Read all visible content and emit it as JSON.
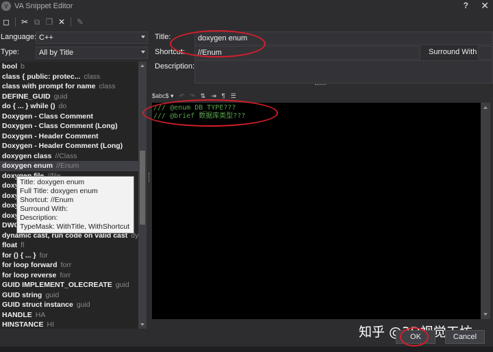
{
  "window": {
    "title": "VA Snippet Editor",
    "help_label": "?",
    "close_label": "✕"
  },
  "toolbar": {
    "icons": [
      "new-icon",
      "cut-icon",
      "copy-icon",
      "paste-icon",
      "delete-icon",
      "edit-icon"
    ]
  },
  "filters": {
    "language_label": "Language:",
    "language_value": "C++",
    "type_label": "Type:",
    "type_value": "All by Title"
  },
  "snippets": [
    {
      "title": "bool",
      "shortcut": "b"
    },
    {
      "title": "class  { public: protec...",
      "shortcut": "class"
    },
    {
      "title": "class with prompt for name",
      "shortcut": "class"
    },
    {
      "title": "DEFINE_GUID",
      "shortcut": "guid"
    },
    {
      "title": "do { ... } while ()",
      "shortcut": "do"
    },
    {
      "title": "Doxygen - Class Comment",
      "shortcut": ""
    },
    {
      "title": "Doxygen - Class Comment (Long)",
      "shortcut": ""
    },
    {
      "title": "Doxygen - Header Comment",
      "shortcut": ""
    },
    {
      "title": "Doxygen - Header Comment (Long)",
      "shortcut": ""
    },
    {
      "title": "doxygen class",
      "shortcut": "//Class"
    },
    {
      "title": "doxygen enum",
      "shortcut": "//Enum"
    },
    {
      "title": "doxygen file",
      "shortcut": "//file"
    },
    {
      "title": "doxygen function",
      "shortcut": ""
    },
    {
      "title": "doxygen group",
      "shortcut": ""
    },
    {
      "title": "doxygen member",
      "shortcut": ""
    },
    {
      "title": "doxygen struct",
      "shortcut": ""
    },
    {
      "title": "DWORD",
      "shortcut": ""
    },
    {
      "title": "dynamic cast, run code on valid cast",
      "shortcut": "dyn"
    },
    {
      "title": "float",
      "shortcut": "fl"
    },
    {
      "title": "for () { ... }",
      "shortcut": "for"
    },
    {
      "title": "for loop forward",
      "shortcut": "forr"
    },
    {
      "title": "for loop reverse",
      "shortcut": "forr"
    },
    {
      "title": "GUID IMPLEMENT_OLECREATE",
      "shortcut": "guid"
    },
    {
      "title": "GUID string",
      "shortcut": "guid"
    },
    {
      "title": "GUID struct instance",
      "shortcut": "guid"
    },
    {
      "title": "HANDLE",
      "shortcut": "HA"
    },
    {
      "title": "HINSTANCE",
      "shortcut": "HI"
    }
  ],
  "tooltip": {
    "lines": [
      "Title: doxygen enum",
      "Full Title: doxygen enum",
      "Shortcut: //Enum",
      "Surround With:",
      "Description:",
      "TypeMask: WithTitle, WithShortcut"
    ]
  },
  "editor_form": {
    "title_label": "Title:",
    "title_value": "doxygen enum",
    "shortcut_label": "Shortcut:",
    "shortcut_value": "//Enum",
    "surround_label": "Surround With",
    "description_label": "Description:"
  },
  "editor_toolbar": {
    "reserved_label": "$abc$",
    "icons": [
      "undo-icon",
      "redo-icon",
      "sort-icon",
      "indent-icon",
      "paragraph-icon",
      "wrap-icon"
    ]
  },
  "code_lines": [
    "/// @enum DB_TYPE???",
    "/// @brief 数据库类型???"
  ],
  "buttons": {
    "ok": "OK",
    "cancel": "Cancel"
  },
  "watermark": "知乎 @3D视觉工坊",
  "colors": {
    "annotation": "#d81e2a",
    "comment": "#57a64a"
  }
}
